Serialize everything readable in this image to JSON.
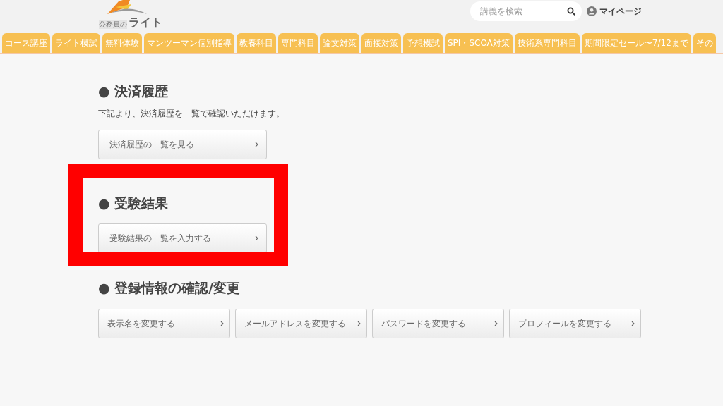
{
  "header": {
    "logo": {
      "small_text": "公務員の",
      "name": "ライト"
    },
    "search": {
      "placeholder": "講義を検索"
    },
    "mypage": "マイページ"
  },
  "nav": [
    {
      "label": "コース講座"
    },
    {
      "label": "ライト模試"
    },
    {
      "label": "無料体験"
    },
    {
      "label": "マンツーマン個別指導"
    },
    {
      "label": "教養科目"
    },
    {
      "label": "専門科目"
    },
    {
      "label": "論文対策"
    },
    {
      "label": "面接対策"
    },
    {
      "label": "予想模試"
    },
    {
      "label": "SPI・SCOA対策"
    },
    {
      "label": "技術系専門科目"
    },
    {
      "label": "期間限定セール〜7/12まで"
    },
    {
      "label": "その"
    }
  ],
  "sections": [
    {
      "heading": "● 決済履歴",
      "description": "下記より、決済履歴を一覧で確認いただけます。",
      "highlighted": false,
      "buttons": [
        "決済履歴の一覧を見る"
      ]
    },
    {
      "heading": "● 受験結果",
      "highlighted": true,
      "buttons": [
        "受験結果の一覧を入力する"
      ]
    },
    {
      "heading": "● 登録情報の確認/変更",
      "highlighted": false,
      "buttons": [
        "表示名を変更する",
        "メールアドレスを変更する",
        "パスワードを変更する",
        "プロフィールを変更する"
      ]
    }
  ]
}
